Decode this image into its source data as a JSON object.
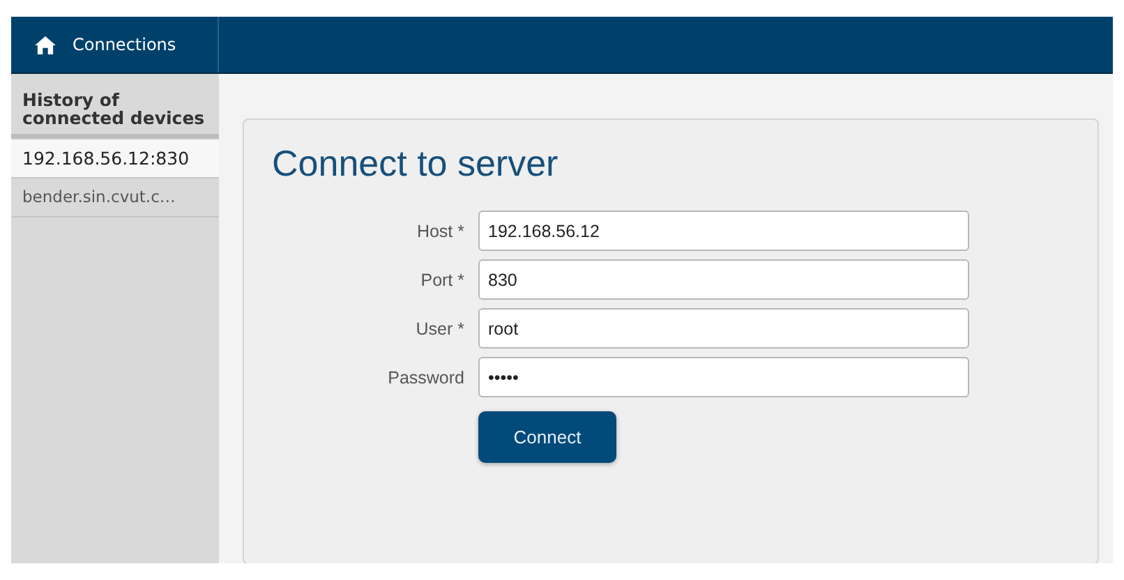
{
  "nav": {
    "title": "Connections"
  },
  "sidebar": {
    "heading": "History of connected devices",
    "items": [
      {
        "label": "192.168.56.12:830",
        "selected": true
      },
      {
        "label": "bender.sin.cvut.c…",
        "selected": false
      }
    ]
  },
  "form": {
    "title": "Connect to server",
    "fields": [
      {
        "label": "Host *",
        "value": "192.168.56.12"
      },
      {
        "label": "Port *",
        "value": "830"
      },
      {
        "label": "User *",
        "value": "root"
      },
      {
        "label": "Password",
        "value": "•••••"
      }
    ],
    "button": "Connect"
  }
}
